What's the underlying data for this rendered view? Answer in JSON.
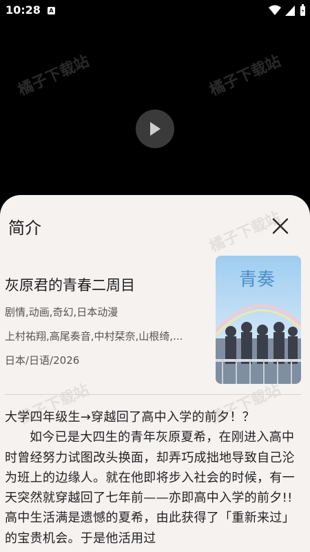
{
  "status_bar": {
    "time": "10:28",
    "notification_icon": "A"
  },
  "watermark": "橘子下载站",
  "player": {
    "play_icon": "play-icon"
  },
  "sheet": {
    "title": "简介",
    "close_icon": "close-icon"
  },
  "anime": {
    "title": "灰原君的青春二周目",
    "genres": "剧情,动画,奇幻,日本动漫",
    "cast": "上村祐翔,高尾奏音,中村栞奈,山根绮,...",
    "info": "日本/日语/2026",
    "poster_title": "青奏"
  },
  "synopsis": {
    "first_line": "大学四年级生→穿越回了高中入学的前夕！？",
    "body": "如今已是大四生的青年灰原夏希，在刚进入高中时曾经努力试图改头换面，却弄巧成拙地导致自己沦为班上的边缘人。就在他即将步入社会的时候，有一天突然就穿越回了七年前——亦即高中入学的前夕!!高中生活满是遗憾的夏希，由此获得了「重新来过」的宝贵机会。于是他活用过"
  },
  "colors": {
    "sheet_bg": "#f6f2f0",
    "player_bg": "#000000"
  }
}
